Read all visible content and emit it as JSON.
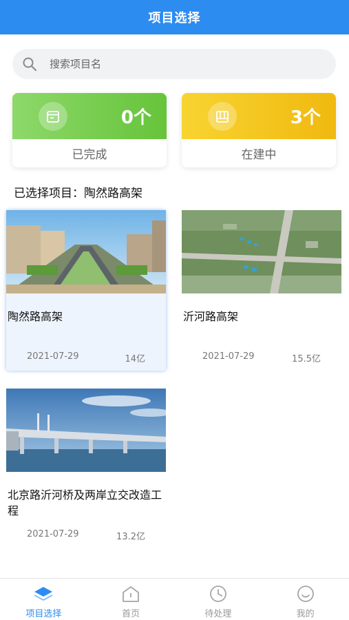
{
  "header": {
    "title": "项目选择"
  },
  "search": {
    "placeholder": "搜索项目名"
  },
  "stats": {
    "completed": {
      "count": "0个",
      "label": "已完成"
    },
    "under_construction": {
      "count": "3个",
      "label": "在建中"
    }
  },
  "selected_project": {
    "text": "已选择项目：陶然路高架"
  },
  "projects": [
    {
      "name": "陶然路高架",
      "date": "2021-07-29",
      "amount": "14亿",
      "selected": true
    },
    {
      "name": "沂河路高架",
      "date": "2021-07-29",
      "amount": "15.5亿",
      "selected": false
    },
    {
      "name": "北京路沂河桥及两岸立交改造工程",
      "date": "2021-07-29",
      "amount": "13.2亿",
      "selected": false
    }
  ],
  "tabbar": {
    "items": [
      {
        "label": "项目选择",
        "icon": "layers-icon",
        "active": true
      },
      {
        "label": "首页",
        "icon": "home-icon",
        "active": false
      },
      {
        "label": "待处理",
        "icon": "clock-icon",
        "active": false
      },
      {
        "label": "我的",
        "icon": "smile-icon",
        "active": false
      }
    ]
  },
  "colors": {
    "primary": "#2d8cf0",
    "completed": "#6cc540",
    "building": "#f2bd14"
  }
}
